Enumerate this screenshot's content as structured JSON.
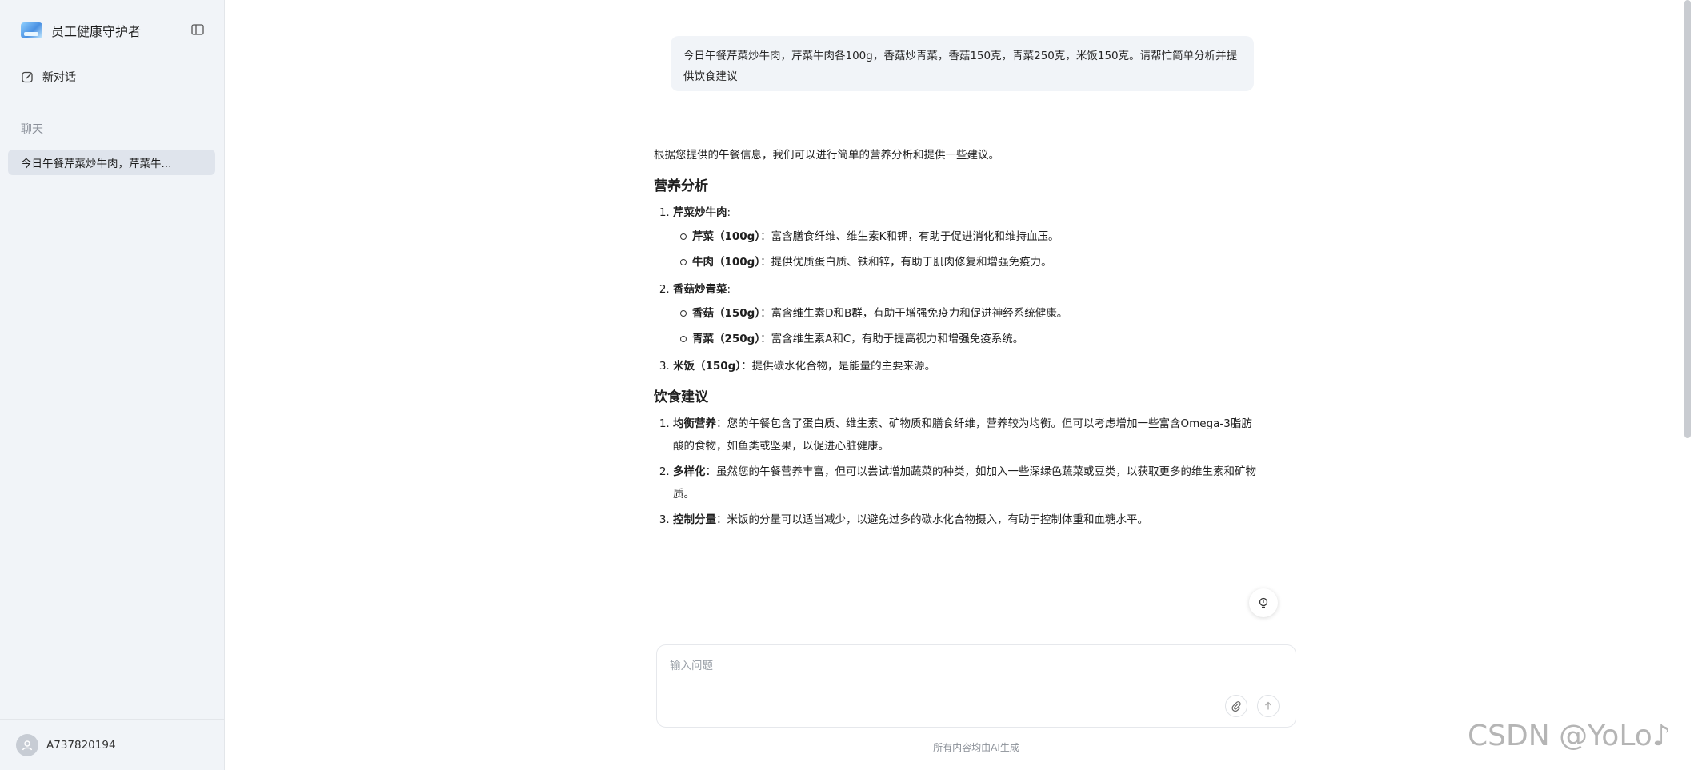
{
  "sidebar": {
    "app_title": "员工健康守护者",
    "new_chat_label": "新对话",
    "section_label": "聊天",
    "history": [
      {
        "title": "今日午餐芹菜炒牛肉，芹菜牛..."
      }
    ],
    "user": {
      "name": "A737820194"
    }
  },
  "chat": {
    "user_message": "今日午餐芹菜炒牛肉，芹菜牛肉各100g，香菇炒青菜，香菇150克，青菜250克，米饭150克。请帮忙简单分析并提供饮食建议",
    "answer": {
      "intro": "根据您提供的午餐信息，我们可以进行简单的营养分析和提供一些建议。",
      "analysis_heading": "营养分析",
      "analysis": [
        {
          "title": "芹菜炒牛肉",
          "suffix": ":",
          "items": [
            {
              "name": "芹菜（100g）",
              "text": "：富含膳食纤维、维生素K和钾，有助于促进消化和维持血压。"
            },
            {
              "name": "牛肉（100g）",
              "text": "：提供优质蛋白质、铁和锌，有助于肌肉修复和增强免疫力。"
            }
          ]
        },
        {
          "title": "香菇炒青菜",
          "suffix": ":",
          "items": [
            {
              "name": "香菇（150g）",
              "text": "：富含维生素D和B群，有助于增强免疫力和促进神经系统健康。"
            },
            {
              "name": "青菜（250g）",
              "text": "：富含维生素A和C，有助于提高视力和增强免疫系统。"
            }
          ]
        },
        {
          "title": "米饭（150g）",
          "suffix": "：提供碳水化合物，是能量的主要来源。",
          "items": []
        }
      ],
      "advice_heading": "饮食建议",
      "advice": [
        {
          "title": "均衡营养",
          "text": "：您的午餐包含了蛋白质、维生素、矿物质和膳食纤维，营养较为均衡。但可以考虑增加一些富含Omega-3脂肪酸的食物，如鱼类或坚果，以促进心脏健康。"
        },
        {
          "title": "多样化",
          "text": "：虽然您的午餐营养丰富，但可以尝试增加蔬菜的种类，如加入一些深绿色蔬菜或豆类，以获取更多的维生素和矿物质。"
        },
        {
          "title": "控制分量",
          "text": "：米饭的分量可以适当减少，以避免过多的碳水化合物摄入，有助于控制体重和血糖水平。"
        }
      ]
    }
  },
  "composer": {
    "placeholder": "输入问题",
    "value": "",
    "disclaimer": "- 所有内容均由AI生成 -"
  },
  "watermark": "CSDN @YoLo♪",
  "icons": {
    "logo": "app-logo-icon",
    "collapse": "sidebar-toggle-icon",
    "new_chat": "edit-icon",
    "avatar": "user-icon",
    "bulb": "lightbulb-icon",
    "attach": "paperclip-icon",
    "send": "arrow-up-icon"
  }
}
